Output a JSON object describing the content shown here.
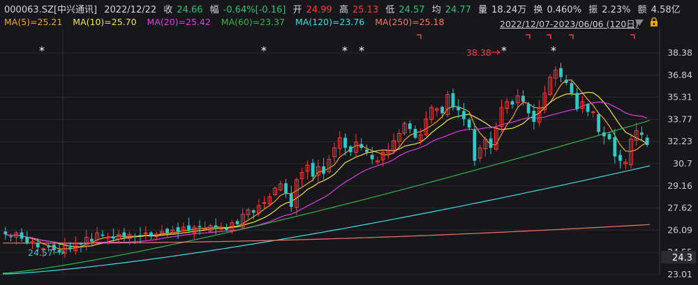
{
  "header": {
    "code": "000063.SZ[中兴通讯]",
    "date": "2022/12/22",
    "close_label": "收",
    "close_value": "24.66",
    "change_label": "幅",
    "change_value": "-0.64%[-0.16]",
    "open_label": "开",
    "open_value": "24.99",
    "high_label": "高",
    "high_value": "25.13",
    "low_label": "低",
    "low_value": "24.57",
    "avg_label": "均",
    "avg_value": "24.77",
    "vol_label": "量",
    "vol_value": "18.24万",
    "turnover_label": "换",
    "turnover_value": "0.460%",
    "amp_label": "振",
    "amp_value": "2.23%",
    "amount_label": "额",
    "amount_value": "4.58亿"
  },
  "ma_legend": [
    {
      "text": "MA(5)=25.21",
      "color": "#f5a623"
    },
    {
      "text": "MA(10)=25.70",
      "color": "#f2e54b"
    },
    {
      "text": "MA(20)=25.42",
      "color": "#e23ce6"
    },
    {
      "text": "MA(60)=23.37",
      "color": "#31b84a"
    },
    {
      "text": "MA(120)=23.76",
      "color": "#3fe0e6"
    },
    {
      "text": "MA(250)=25.18",
      "color": "#f07a6a"
    }
  ],
  "range_label": "2022/12/07-2023/06/06 (120日)",
  "colors": {
    "up": "#ff3b3b",
    "down": "#2fc9c9",
    "ma5": "#f5a623",
    "ma10": "#f2e54b",
    "ma20": "#e23ce6",
    "ma60": "#31b84a",
    "ma120": "#3fe0e6",
    "ma250": "#f07a6a"
  },
  "chart_data": {
    "type": "candlestick",
    "y_ticks": [
      "38.38",
      "36.84",
      "35.31",
      "33.77",
      "32.23",
      "30.7",
      "29.16",
      "27.62",
      "26.09",
      "24.55",
      "23.01"
    ],
    "ylim": [
      23.01,
      38.38
    ],
    "last_price_tag": "24.3",
    "max_marker": "38.38",
    "min_marker": "24.57",
    "closes": [
      25.8,
      25.6,
      25.9,
      25.5,
      25.2,
      25.3,
      24.9,
      24.8,
      24.9,
      24.7,
      24.6,
      25.0,
      24.8,
      25.2,
      25.1,
      25.6,
      25.3,
      25.9,
      25.7,
      25.6,
      25.5,
      25.8,
      25.6,
      25.8,
      25.6,
      25.7,
      25.9,
      25.7,
      25.8,
      26.0,
      25.9,
      26.1,
      26.0,
      26.3,
      26.1,
      26.3,
      26.3,
      26.2,
      26.4,
      26.3,
      26.3,
      26.1,
      26.6,
      26.5,
      27.2,
      27.5,
      27.3,
      27.8,
      28.0,
      28.4,
      29.0,
      29.3,
      28.6,
      27.7,
      29.6,
      30.1,
      30.6,
      29.8,
      30.5,
      30.0,
      31.0,
      31.8,
      32.5,
      31.8,
      31.5,
      32.2,
      31.8,
      31.5,
      31.0,
      30.9,
      31.5,
      31.6,
      32.3,
      32.8,
      33.5,
      33.1,
      32.5,
      32.7,
      33.8,
      34.6,
      34.5,
      34.2,
      35.5,
      34.6,
      34.4,
      33.8,
      33.2,
      30.9,
      31.8,
      32.4,
      31.8,
      33.2,
      34.6,
      35.0,
      34.8,
      35.4,
      35.0,
      34.2,
      33.6,
      34.6,
      35.6,
      36.7,
      37.2,
      36.7,
      36.3,
      35.6,
      34.5,
      35.0,
      34.3,
      34.3,
      32.9,
      32.6,
      32.4,
      31.2,
      30.9,
      30.8,
      32.4,
      33.0,
      32.7,
      32.0
    ],
    "ma_series": {
      "MA5": "light orange smoothed",
      "MA10": "yellow",
      "MA20": "magenta",
      "MA60": "green",
      "MA120": "cyan",
      "MA250": "salmon"
    }
  }
}
